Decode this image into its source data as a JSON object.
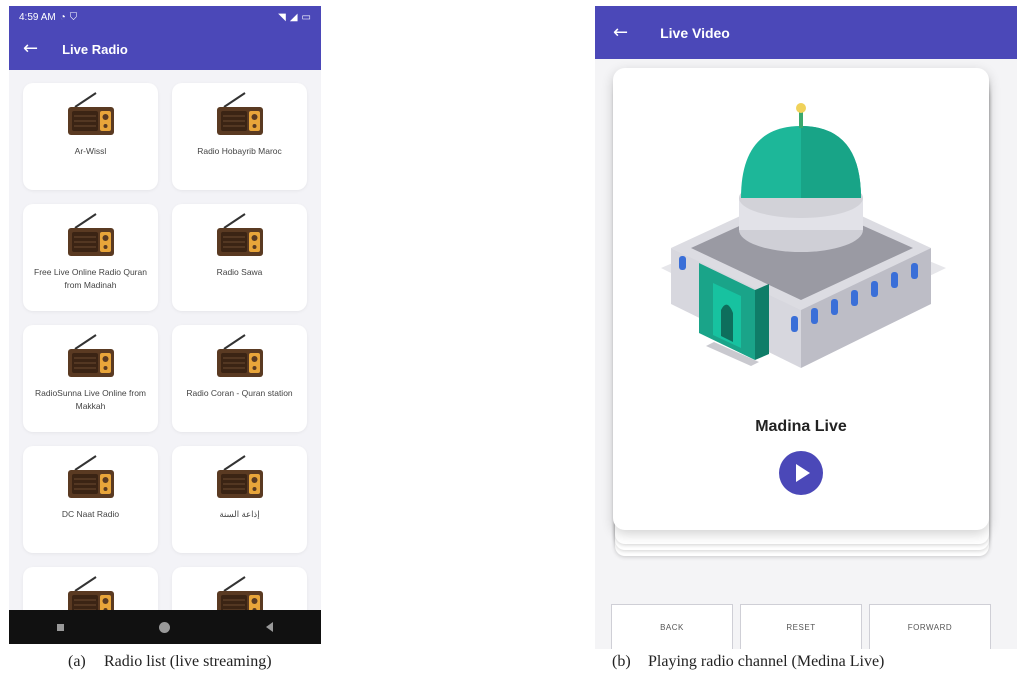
{
  "phone_a": {
    "status_bar": {
      "time": "4:59 AM",
      "icons_left": [
        "signal-dot-icon",
        "shield-icon"
      ],
      "icons_right": [
        "wifi-icon",
        "signal-icon",
        "signal-icon",
        "battery-icon"
      ]
    },
    "app_bar": {
      "title": "Live Radio",
      "back_icon": "arrow-left-icon"
    },
    "items": [
      {
        "label": "Ar-Wissl",
        "icon": "radio-icon"
      },
      {
        "label": "Radio Hobayrib Maroc",
        "icon": "radio-icon"
      },
      {
        "label": "Free Live Online Radio Quran from Madinah",
        "icon": "radio-icon"
      },
      {
        "label": "Radio Sawa",
        "icon": "radio-icon"
      },
      {
        "label": "RadioSunna Live Online from Makkah",
        "icon": "radio-icon"
      },
      {
        "label": "Radio Coran - Quran station",
        "icon": "radio-icon"
      },
      {
        "label": "DC Naat Radio",
        "icon": "radio-icon"
      },
      {
        "label": "إذاعة السنة",
        "icon": "radio-icon"
      },
      {
        "label": "",
        "icon": "radio-icon"
      },
      {
        "label": "",
        "icon": "radio-icon"
      }
    ],
    "nav_bar": [
      "square-icon",
      "circle-icon",
      "back-triangle-icon"
    ]
  },
  "phone_b": {
    "app_bar": {
      "title": "Live Video",
      "back_icon": "arrow-left-icon"
    },
    "channel_name": "Madina Live",
    "play_icon": "play-icon",
    "controls": {
      "back": "BACK",
      "reset": "RESET",
      "forward": "FORWARD"
    }
  },
  "captions": {
    "a": {
      "num": "(a)",
      "text": "Radio list (live streaming)"
    },
    "b": {
      "num": "(b)",
      "text": "Playing radio channel (Medina Live)"
    }
  },
  "colors": {
    "primary": "#4b48b8",
    "radio_body": "#5a3a22",
    "radio_panel": "#e8a53a",
    "dome": "#1db799",
    "window": "#3a6fd8"
  }
}
